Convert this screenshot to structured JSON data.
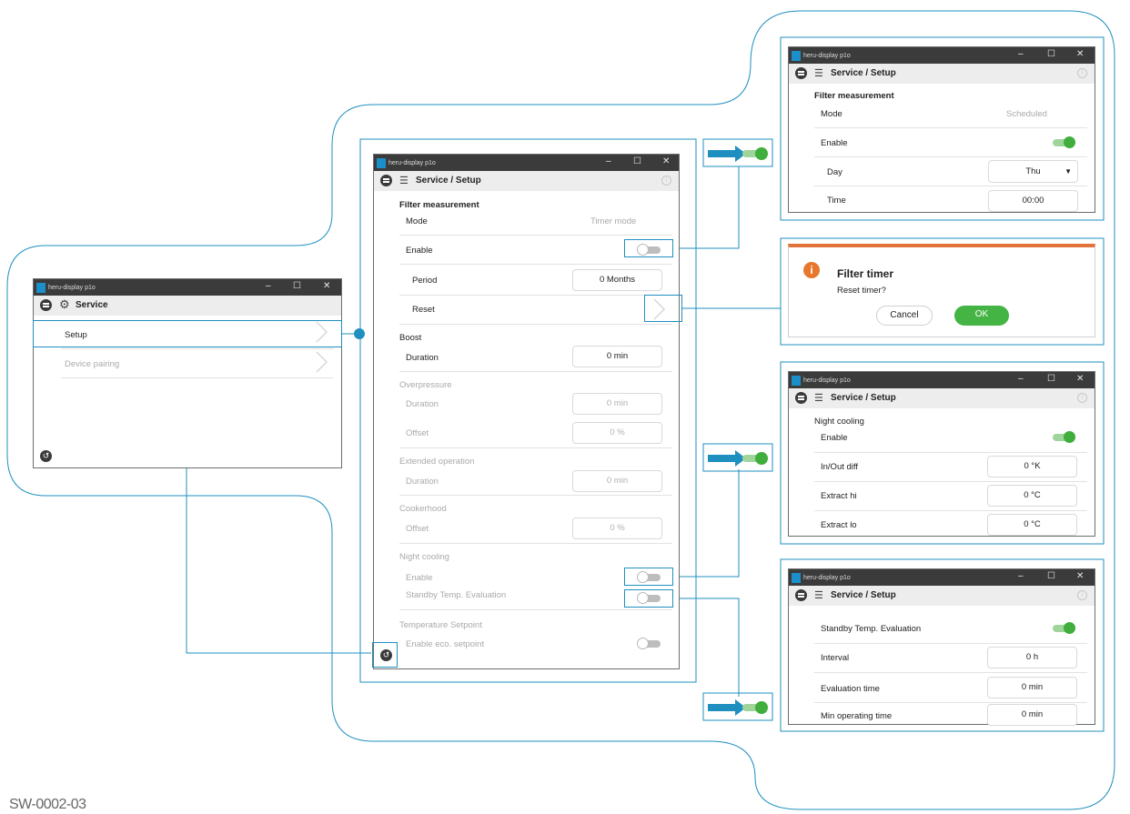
{
  "doc_code": "SW-0002-03",
  "win_service": {
    "app": "heru-display p1o",
    "title": "Service",
    "items": [
      "Setup",
      "Device pairing"
    ]
  },
  "win_main": {
    "app": "heru-display p1o",
    "title": "Service / Setup",
    "filter_heading": "Filter measurement",
    "mode_label": "Mode",
    "mode_value": "Timer mode",
    "enable_label": "Enable",
    "period_label": "Period",
    "period_value": "0 Months",
    "reset_label": "Reset",
    "boost_heading": "Boost",
    "boost_duration_label": "Duration",
    "boost_duration_value": "0 min",
    "over_heading": "Overpressure",
    "over_duration_label": "Duration",
    "over_duration_value": "0 min",
    "over_offset_label": "Offset",
    "over_offset_value": "0 %",
    "ext_heading": "Extended operation",
    "ext_duration_label": "Duration",
    "ext_duration_value": "0 min",
    "cook_heading": "Cookerhood",
    "cook_offset_label": "Offset",
    "cook_offset_value": "0 %",
    "night_heading": "Night cooling",
    "night_enable_label": "Enable",
    "standby_label": "Standby Temp. Evaluation",
    "temp_heading": "Temperature Setpoint",
    "eco_label": "Enable eco. setpoint"
  },
  "win_filter": {
    "app": "heru-display p1o",
    "title": "Service / Setup",
    "heading": "Filter measurement",
    "mode_label": "Mode",
    "mode_value": "Scheduled",
    "enable_label": "Enable",
    "day_label": "Day",
    "day_value": "Thu",
    "time_label": "Time",
    "time_value": "00:00"
  },
  "dialog": {
    "title": "Filter timer",
    "message": "Reset timer?",
    "cancel": "Cancel",
    "ok": "OK"
  },
  "win_night": {
    "app": "heru-display p1o",
    "title": "Service / Setup",
    "heading": "Night cooling",
    "enable_label": "Enable",
    "inout_label": "In/Out diff",
    "inout_value": "0 °K",
    "exhi_label": "Extract hi",
    "exhi_value": "0 °C",
    "exlo_label": "Extract lo",
    "exlo_value": "0 °C"
  },
  "win_standby": {
    "app": "heru-display p1o",
    "title": "Service / Setup",
    "standby_label": "Standby Temp. Evaluation",
    "interval_label": "Interval",
    "interval_value": "0 h",
    "evaltime_label": "Evaluation time",
    "evaltime_value": "0 min",
    "minop_label": "Min operating time",
    "minop_value": "0 min"
  }
}
